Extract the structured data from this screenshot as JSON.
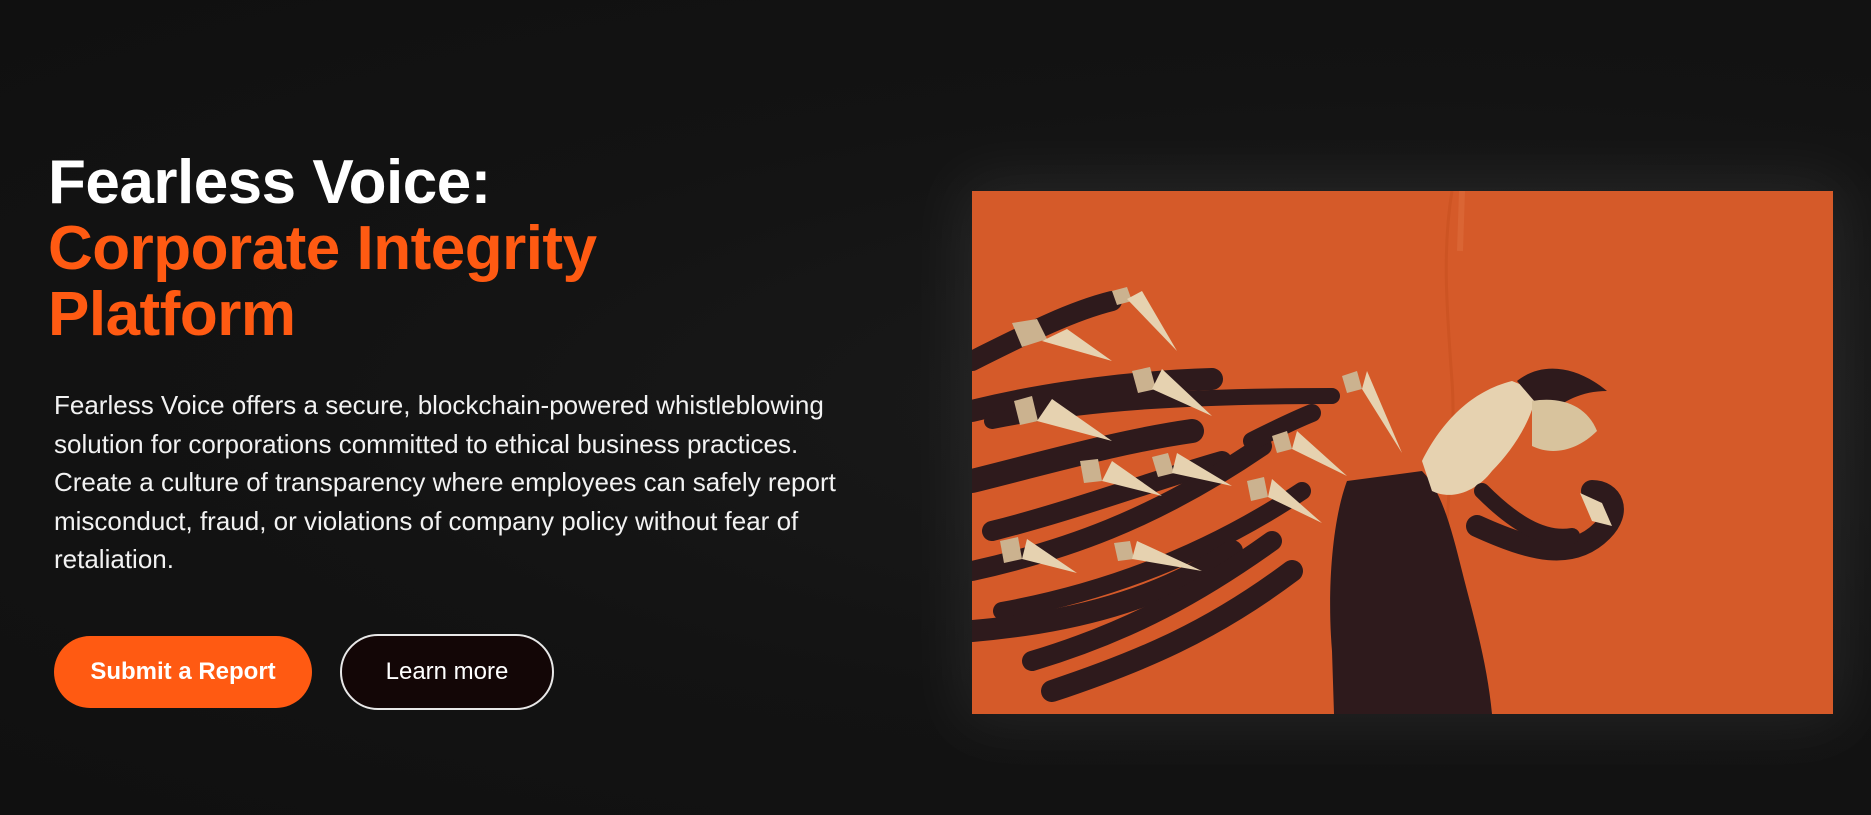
{
  "hero": {
    "title_line1": "Fearless Voice:",
    "title_line2": "Corporate Integrity",
    "title_line3": "Platform",
    "description": "Fearless Voice offers a secure, blockchain-powered whistleblowing solution for corporations committed to ethical business practices. Create a culture of transparency where employees can safely report misconduct, fraud, or violations of company policy without fear of retaliation.",
    "primary_button": "Submit a Report",
    "secondary_button": "Learn more"
  },
  "illustration": {
    "icon": "figure-surrounded-by-knife-hands-illustration"
  },
  "colors": {
    "background": "#121212",
    "accent": "#ff5a12",
    "illustration_bg": "#d55a29",
    "arm_dark": "#2e1a1c",
    "blade_light": "#e6d2b0"
  }
}
